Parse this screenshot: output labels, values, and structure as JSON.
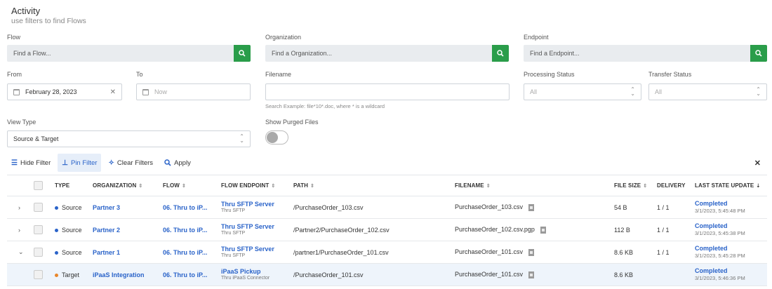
{
  "page": {
    "title": "Activity",
    "subtitle": "use filters to find Flows"
  },
  "filters": {
    "flow": {
      "label": "Flow",
      "placeholder": "Find a Flow..."
    },
    "organization": {
      "label": "Organization",
      "placeholder": "Find a Organization..."
    },
    "endpoint": {
      "label": "Endpoint",
      "placeholder": "Find a Endpoint..."
    },
    "from": {
      "label": "From",
      "value": "February 28, 2023"
    },
    "to": {
      "label": "To",
      "placeholder": "Now"
    },
    "filename": {
      "label": "Filename",
      "value": "",
      "hint": "Search Example: file*10*.doc, where * is a wildcard"
    },
    "processing_status": {
      "label": "Processing Status",
      "value": "All"
    },
    "transfer_status": {
      "label": "Transfer Status",
      "value": "All"
    },
    "view_type": {
      "label": "View Type",
      "value": "Source & Target"
    },
    "show_purged": {
      "label": "Show Purged Files",
      "on": false
    }
  },
  "toolbar": {
    "hide_filter": "Hide Filter",
    "pin_filter": "Pin Filter",
    "clear_filters": "Clear Filters",
    "apply": "Apply"
  },
  "table": {
    "columns": {
      "type": "TYPE",
      "organization": "ORGANIZATION",
      "flow": "FLOW",
      "flow_endpoint": "FLOW ENDPOINT",
      "path": "PATH",
      "filename": "FILENAME",
      "file_size": "FILE SIZE",
      "delivery": "DELIVERY",
      "last_state_update": "LAST STATE UPDATE"
    },
    "rows": [
      {
        "expander": "›",
        "type": "Source",
        "type_color": "#2a63c9",
        "organization": "Partner 3",
        "flow": "06. Thru to iP...",
        "endpoint": "Thru SFTP Server",
        "endpoint_sub": "Thru SFTP",
        "path": "/PurchaseOrder_103.csv",
        "filename": "PurchaseOrder_103.csv",
        "size": "54 B",
        "delivery": "1 / 1",
        "status": "Completed",
        "timestamp": "3/1/2023, 5:45:48 PM"
      },
      {
        "expander": "›",
        "type": "Source",
        "type_color": "#2a63c9",
        "organization": "Partner 2",
        "flow": "06. Thru to iP...",
        "endpoint": "Thru SFTP Server",
        "endpoint_sub": "Thru SFTP",
        "path": "/Partner2/PurchaseOrder_102.csv",
        "filename": "PurchaseOrder_102.csv.pgp",
        "size": "112 B",
        "delivery": "1 / 1",
        "status": "Completed",
        "timestamp": "3/1/2023, 5:45:38 PM"
      },
      {
        "expander": "⌄",
        "type": "Source",
        "type_color": "#2a63c9",
        "organization": "Partner 1",
        "flow": "06. Thru to iP...",
        "endpoint": "Thru SFTP Server",
        "endpoint_sub": "Thru SFTP",
        "path": "/partner1/PurchaseOrder_101.csv",
        "filename": "PurchaseOrder_101.csv",
        "size": "8.6 KB",
        "delivery": "1 / 1",
        "status": "Completed",
        "timestamp": "3/1/2023, 5:45:28 PM"
      },
      {
        "expander": "",
        "type": "Target",
        "type_color": "#e8862a",
        "organization": "iPaaS Integration",
        "flow": "06. Thru to iP...",
        "endpoint": "iPaaS Pickup",
        "endpoint_sub": "Thru iPaaS Connector",
        "path": "/PurchaseOrder_101.csv",
        "filename": "PurchaseOrder_101.csv",
        "size": "8.6 KB",
        "delivery": "",
        "status": "Completed",
        "timestamp": "3/1/2023, 5:46:36 PM"
      }
    ]
  },
  "colors": {
    "accent": "#2a63c9",
    "search_button": "#2a9d4a",
    "target_dot": "#e8862a"
  }
}
